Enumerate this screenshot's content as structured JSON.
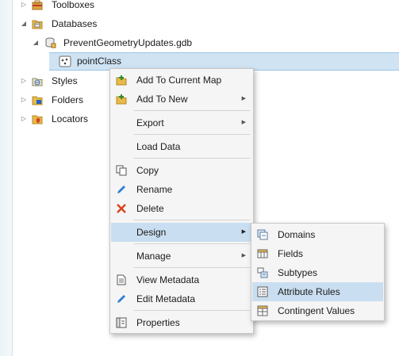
{
  "tree": {
    "toolboxes": "Toolboxes",
    "databases": "Databases",
    "gdb": "PreventGeometryUpdates.gdb",
    "feature_class": "pointClass",
    "styles": "Styles",
    "folders": "Folders",
    "locators": "Locators"
  },
  "context_menu": {
    "add_to_current_map": "Add To Current Map",
    "add_to_new": "Add To New",
    "export": "Export",
    "load_data": "Load Data",
    "copy": "Copy",
    "rename": "Rename",
    "delete": "Delete",
    "design": "Design",
    "manage": "Manage",
    "view_metadata": "View Metadata",
    "edit_metadata": "Edit Metadata",
    "properties": "Properties"
  },
  "design_submenu": {
    "domains": "Domains",
    "fields": "Fields",
    "subtypes": "Subtypes",
    "attribute_rules": "Attribute Rules",
    "contingent_values": "Contingent Values"
  },
  "colors": {
    "highlight": "#c9def0",
    "selection": "#cfe3f3",
    "folder": "#e9b949",
    "delete": "#d9421c",
    "pencil": "#2f7fd1"
  }
}
